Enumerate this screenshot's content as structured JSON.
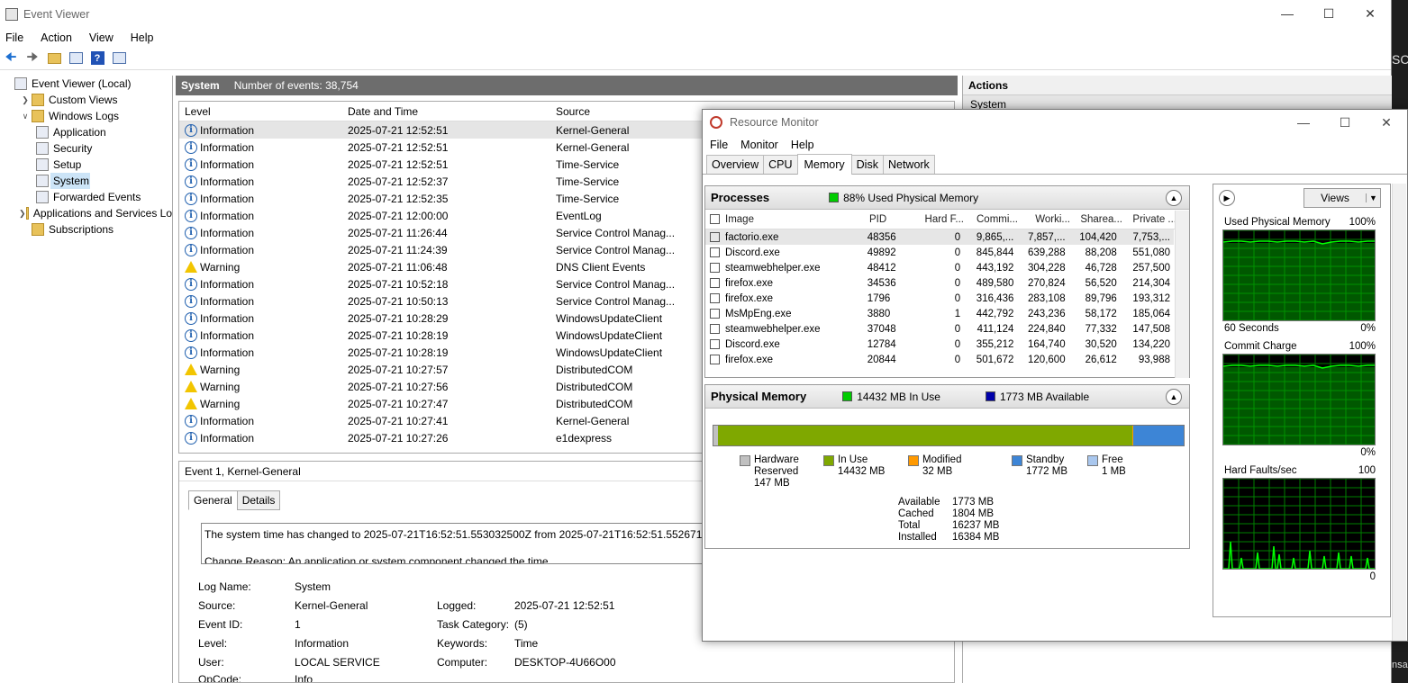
{
  "event_viewer": {
    "title": "Event Viewer",
    "menu": [
      "File",
      "Action",
      "View",
      "Help"
    ],
    "tree": [
      {
        "label": "Event Viewer (Local)",
        "level": 0,
        "expander": ""
      },
      {
        "label": "Custom Views",
        "level": 1,
        "expander": ">"
      },
      {
        "label": "Windows Logs",
        "level": 1,
        "expander": "v"
      },
      {
        "label": "Application",
        "level": 2,
        "expander": ""
      },
      {
        "label": "Security",
        "level": 2,
        "expander": ""
      },
      {
        "label": "Setup",
        "level": 2,
        "expander": ""
      },
      {
        "label": "System",
        "level": 2,
        "expander": "",
        "selected": true
      },
      {
        "label": "Forwarded Events",
        "level": 2,
        "expander": ""
      },
      {
        "label": "Applications and Services Lo",
        "level": 1,
        "expander": ">"
      },
      {
        "label": "Subscriptions",
        "level": 1,
        "expander": ""
      }
    ],
    "log_header": {
      "name": "System",
      "count": "Number of events: 38,754"
    },
    "columns": [
      "Level",
      "Date and Time",
      "Source"
    ],
    "events": [
      {
        "level": "Information",
        "time": "2025-07-21 12:52:51",
        "source": "Kernel-General"
      },
      {
        "level": "Information",
        "time": "2025-07-21 12:52:51",
        "source": "Kernel-General"
      },
      {
        "level": "Information",
        "time": "2025-07-21 12:52:51",
        "source": "Time-Service"
      },
      {
        "level": "Information",
        "time": "2025-07-21 12:52:37",
        "source": "Time-Service"
      },
      {
        "level": "Information",
        "time": "2025-07-21 12:52:35",
        "source": "Time-Service"
      },
      {
        "level": "Information",
        "time": "2025-07-21 12:00:00",
        "source": "EventLog"
      },
      {
        "level": "Information",
        "time": "2025-07-21 11:26:44",
        "source": "Service Control Manag..."
      },
      {
        "level": "Information",
        "time": "2025-07-21 11:24:39",
        "source": "Service Control Manag..."
      },
      {
        "level": "Warning",
        "time": "2025-07-21 11:06:48",
        "source": "DNS Client Events"
      },
      {
        "level": "Information",
        "time": "2025-07-21 10:52:18",
        "source": "Service Control Manag..."
      },
      {
        "level": "Information",
        "time": "2025-07-21 10:50:13",
        "source": "Service Control Manag..."
      },
      {
        "level": "Information",
        "time": "2025-07-21 10:28:29",
        "source": "WindowsUpdateClient"
      },
      {
        "level": "Information",
        "time": "2025-07-21 10:28:19",
        "source": "WindowsUpdateClient"
      },
      {
        "level": "Information",
        "time": "2025-07-21 10:28:19",
        "source": "WindowsUpdateClient"
      },
      {
        "level": "Warning",
        "time": "2025-07-21 10:27:57",
        "source": "DistributedCOM"
      },
      {
        "level": "Warning",
        "time": "2025-07-21 10:27:56",
        "source": "DistributedCOM"
      },
      {
        "level": "Warning",
        "time": "2025-07-21 10:27:47",
        "source": "DistributedCOM"
      },
      {
        "level": "Information",
        "time": "2025-07-21 10:27:41",
        "source": "Kernel-General"
      },
      {
        "level": "Information",
        "time": "2025-07-21 10:27:26",
        "source": "e1dexpress"
      }
    ],
    "detail": {
      "header": "Event 1, Kernel-General",
      "tabs": [
        "General",
        "Details"
      ],
      "message_line1": "The system time has changed to 2025-07-21T16:52:51.553032500Z from 2025-07-21T16:52:51.552671900Z.",
      "message_line2": "Change Reason: An application or system component changed the time.",
      "log_name_label": "Log Name:",
      "log_name": "System",
      "source_label": "Source:",
      "source": "Kernel-General",
      "logged_label": "Logged:",
      "logged": "2025-07-21 12:52:51",
      "event_id_label": "Event ID:",
      "event_id": "1",
      "task_label": "Task Category:",
      "task": "(5)",
      "level_label": "Level:",
      "level": "Information",
      "keywords_label": "Keywords:",
      "keywords": "Time",
      "user_label": "User:",
      "user": "LOCAL SERVICE",
      "computer_label": "Computer:",
      "computer": "DESKTOP-4U66O00",
      "opcode_label": "OpCode:",
      "opcode": "Info"
    },
    "actions_header": "Actions",
    "actions_first": "System"
  },
  "resource_monitor": {
    "title": "Resource Monitor",
    "menu": [
      "File",
      "Monitor",
      "Help"
    ],
    "tabs": [
      "Overview",
      "CPU",
      "Memory",
      "Disk",
      "Network"
    ],
    "active_tab": "Memory",
    "processes": {
      "title": "Processes",
      "summary": "88% Used Physical Memory",
      "columns": [
        "Image",
        "PID",
        "Hard F...",
        "Commi...",
        "Worki...",
        "Sharea...",
        "Private ..."
      ],
      "rows": [
        [
          "factorio.exe",
          "48356",
          "0",
          "9,865,...",
          "7,857,...",
          "104,420",
          "7,753,..."
        ],
        [
          "Discord.exe",
          "49892",
          "0",
          "845,844",
          "639,288",
          "88,208",
          "551,080"
        ],
        [
          "steamwebhelper.exe",
          "48412",
          "0",
          "443,192",
          "304,228",
          "46,728",
          "257,500"
        ],
        [
          "firefox.exe",
          "34536",
          "0",
          "489,580",
          "270,824",
          "56,520",
          "214,304"
        ],
        [
          "firefox.exe",
          "1796",
          "0",
          "316,436",
          "283,108",
          "89,796",
          "193,312"
        ],
        [
          "MsMpEng.exe",
          "3880",
          "1",
          "442,792",
          "243,236",
          "58,172",
          "185,064"
        ],
        [
          "steamwebhelper.exe",
          "37048",
          "0",
          "411,124",
          "224,840",
          "77,332",
          "147,508"
        ],
        [
          "Discord.exe",
          "12784",
          "0",
          "355,212",
          "164,740",
          "30,520",
          "134,220"
        ],
        [
          "firefox.exe",
          "20844",
          "0",
          "501,672",
          "120,600",
          "26,612",
          "93,988"
        ]
      ]
    },
    "physical": {
      "title": "Physical Memory",
      "in_use_summary": "14432 MB In Use",
      "available_summary": "1773 MB Available",
      "legend": [
        {
          "name": "Hardware Reserved",
          "value": "147 MB",
          "color": "#c0c0c0"
        },
        {
          "name": "In Use",
          "value": "14432 MB",
          "color": "#7fa800"
        },
        {
          "name": "Modified",
          "value": "32 MB",
          "color": "#ff9900"
        },
        {
          "name": "Standby",
          "value": "1772 MB",
          "color": "#3d85d6"
        },
        {
          "name": "Free",
          "value": "1 MB",
          "color": "#a9c7ee"
        }
      ],
      "stats": [
        {
          "label": "Available",
          "value": "1773 MB"
        },
        {
          "label": "Cached",
          "value": "1804 MB"
        },
        {
          "label": "Total",
          "value": "16237 MB"
        },
        {
          "label": "Installed",
          "value": "16384 MB"
        }
      ],
      "bar_fractions": {
        "reserved": 0.009,
        "in_use": 0.881,
        "modified": 0.002,
        "standby": 0.108,
        "free": 0.0
      }
    },
    "views_label": "Views",
    "graphs": [
      {
        "title": "Used Physical Memory",
        "max": "100%",
        "min": "0%",
        "bottom_left": "60 Seconds"
      },
      {
        "title": "Commit Charge",
        "max": "100%",
        "min": "0%",
        "bottom_left": ""
      },
      {
        "title": "Hard Faults/sec",
        "max": "100",
        "min": "0",
        "bottom_left": ""
      }
    ],
    "colors": {
      "graph_line": "#00ff00",
      "graph_grid": "#008000",
      "used_square": "#00cc00",
      "available_square": "#0000aa"
    }
  },
  "edge_text": {
    "top": "SC",
    "bottom": "nsa"
  }
}
